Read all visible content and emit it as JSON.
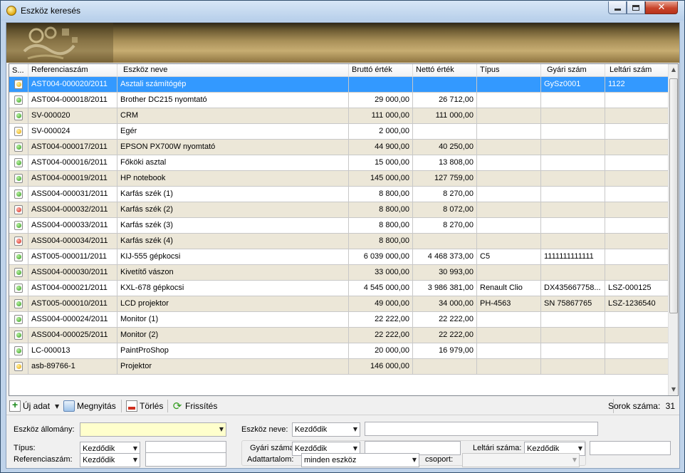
{
  "window": {
    "title": "Eszköz keresés"
  },
  "grid": {
    "columns": [
      "S...",
      "Referenciaszám",
      "Eszköz neve",
      "Bruttó érték",
      "Nettó érték",
      "Típus",
      "Gyári szám",
      "Leltári szám"
    ],
    "rows": [
      {
        "status": "yellow",
        "ref": "AST004-000020/2011",
        "name": "Asztali számítógép",
        "brutto": "",
        "netto": "",
        "tipus": "",
        "gyari": "GySz0001",
        "leltari": "1122",
        "selected": true
      },
      {
        "status": "green",
        "ref": "AST004-000018/2011",
        "name": "Brother DC215 nyomtató",
        "brutto": "29 000,00",
        "netto": "26 712,00",
        "tipus": "",
        "gyari": "",
        "leltari": ""
      },
      {
        "status": "green",
        "ref": "SV-000020",
        "name": "CRM",
        "brutto": "111 000,00",
        "netto": "111 000,00",
        "tipus": "",
        "gyari": "",
        "leltari": ""
      },
      {
        "status": "yellow",
        "ref": "SV-000024",
        "name": "Egér",
        "brutto": "2 000,00",
        "netto": "",
        "tipus": "",
        "gyari": "",
        "leltari": ""
      },
      {
        "status": "green",
        "ref": "AST004-000017/2011",
        "name": "EPSON PX700W nyomtató",
        "brutto": "44 900,00",
        "netto": "40 250,00",
        "tipus": "",
        "gyari": "",
        "leltari": ""
      },
      {
        "status": "green",
        "ref": "AST004-000016/2011",
        "name": "Főköki asztal",
        "brutto": "15 000,00",
        "netto": "13 808,00",
        "tipus": "",
        "gyari": "",
        "leltari": ""
      },
      {
        "status": "green",
        "ref": "AST004-000019/2011",
        "name": "HP notebook",
        "brutto": "145 000,00",
        "netto": "127 759,00",
        "tipus": "",
        "gyari": "",
        "leltari": ""
      },
      {
        "status": "green",
        "ref": "ASS004-000031/2011",
        "name": "Karfás szék (1)",
        "brutto": "8 800,00",
        "netto": "8 270,00",
        "tipus": "",
        "gyari": "",
        "leltari": ""
      },
      {
        "status": "red",
        "ref": "ASS004-000032/2011",
        "name": "Karfás szék (2)",
        "brutto": "8 800,00",
        "netto": "8 072,00",
        "tipus": "",
        "gyari": "",
        "leltari": ""
      },
      {
        "status": "green",
        "ref": "ASS004-000033/2011",
        "name": "Karfás szék (3)",
        "brutto": "8 800,00",
        "netto": "8 270,00",
        "tipus": "",
        "gyari": "",
        "leltari": ""
      },
      {
        "status": "red",
        "ref": "ASS004-000034/2011",
        "name": "Karfás szék (4)",
        "brutto": "8 800,00",
        "netto": "",
        "tipus": "",
        "gyari": "",
        "leltari": ""
      },
      {
        "status": "green",
        "ref": "AST005-000011/2011",
        "name": "KIJ-555 gépkocsi",
        "brutto": "6 039 000,00",
        "netto": "4 468 373,00",
        "tipus": "C5",
        "gyari": "1111111111111",
        "leltari": ""
      },
      {
        "status": "green",
        "ref": "ASS004-000030/2011",
        "name": "Kivetítő vászon",
        "brutto": "33 000,00",
        "netto": "30 993,00",
        "tipus": "",
        "gyari": "",
        "leltari": ""
      },
      {
        "status": "green",
        "ref": "AST004-000021/2011",
        "name": "KXL-678 gépkocsi",
        "brutto": "4 545 000,00",
        "netto": "3 986 381,00",
        "tipus": "Renault Clio",
        "gyari": "DX435667758...",
        "leltari": "LSZ-000125"
      },
      {
        "status": "green",
        "ref": "AST005-000010/2011",
        "name": "LCD projektor",
        "brutto": "49 000,00",
        "netto": "34 000,00",
        "tipus": "PH-4563",
        "gyari": "SN 75867765",
        "leltari": "LSZ-1236540"
      },
      {
        "status": "green",
        "ref": "ASS004-000024/2011",
        "name": "Monitor (1)",
        "brutto": "22 222,00",
        "netto": "22 222,00",
        "tipus": "",
        "gyari": "",
        "leltari": ""
      },
      {
        "status": "green",
        "ref": "ASS004-000025/2011",
        "name": "Monitor (2)",
        "brutto": "22 222,00",
        "netto": "22 222,00",
        "tipus": "",
        "gyari": "",
        "leltari": ""
      },
      {
        "status": "green",
        "ref": "LC-000013",
        "name": "PaintProShop",
        "brutto": "20 000,00",
        "netto": "16 979,00",
        "tipus": "",
        "gyari": "",
        "leltari": ""
      },
      {
        "status": "yellow",
        "ref": "asb-89766-1",
        "name": "Projektor",
        "brutto": "146 000,00",
        "netto": "",
        "tipus": "",
        "gyari": "",
        "leltari": ""
      }
    ]
  },
  "toolbar": {
    "new_label": "Új adat",
    "open_label": "Megnyitás",
    "delete_label": "Törlés",
    "refresh_label": "Frissítés",
    "row_count_label": "Sorok száma:",
    "row_count_value": "31"
  },
  "filters": {
    "asset_stock_label": "Eszköz állomány:",
    "asset_stock_value": "",
    "asset_name_label": "Eszköz neve:",
    "asset_name_mode": "Kezdődik",
    "asset_name_value": "",
    "type_label": "Típus:",
    "type_mode": "Kezdődik",
    "type_value": "",
    "serial_label": "Gyári száma:",
    "serial_mode": "Kezdődik",
    "serial_value": "",
    "inventory_label": "Leltári száma:",
    "inventory_mode": "Kezdődik",
    "inventory_value": "",
    "ref_label": "Referenciaszám:",
    "ref_mode": "Kezdődik",
    "ref_value": "",
    "content_label": "Adattartalom:",
    "content_value": "minden eszköz",
    "group_label": "csoport:",
    "group_value": ""
  },
  "colors": {
    "selection": "#3399ff",
    "alt_row": "#ece7d8",
    "required_field": "#ffffcc"
  }
}
